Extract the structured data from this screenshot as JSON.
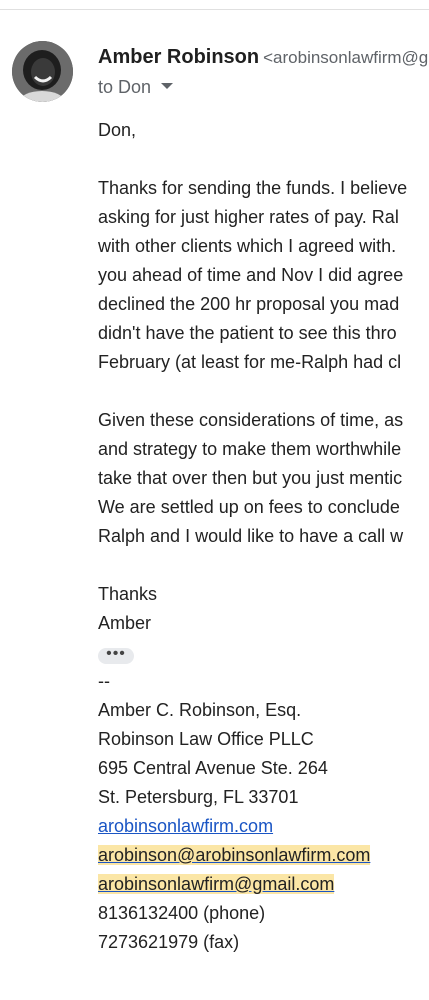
{
  "message": {
    "sender_name": "Amber Robinson",
    "sender_email": "<arobinsonlawfirm@gmail.com>",
    "to_label": "to Don",
    "greeting": "Don,",
    "paragraph1": [
      "Thanks for sending the funds. I believe",
      "asking for just higher rates of pay. Ral",
      "with other clients which I agreed with.",
      "you ahead of time and Nov I did agree",
      "declined the 200 hr proposal you mad",
      "didn't have the patient to see this thro",
      "February (at least for me-Ralph had cl"
    ],
    "paragraph2": [
      "Given these considerations of time, as",
      "and strategy to make them worthwhile",
      "take that over then but you just mentic",
      "We are settled up on fees to conclude",
      "Ralph and I would like to have a call w"
    ],
    "signoff": "Thanks",
    "signoff_name": "Amber",
    "ellipsis": "•••",
    "signature": {
      "separator": "--",
      "name": "Amber C. Robinson, Esq.",
      "firm": "Robinson Law Office PLLC",
      "address1": "695 Central Avenue Ste. 264",
      "address2": "St. Petersburg, FL 33701",
      "website": "arobinsonlawfirm.com",
      "email1": "arobinson@arobinsonlawfirm.com",
      "email2": "arobinsonlawfirm@gmail.com",
      "phone": "8136132400 (phone)",
      "fax": "7273621979 (fax)"
    }
  },
  "colors": {
    "link": "#1a55c4",
    "highlight": "#fbe6a6",
    "secondary_text": "#5f6368"
  },
  "icons": {
    "avatar": "sender-avatar",
    "caret": "chevron-down-icon",
    "ellipsis": "more-horiz-icon"
  }
}
